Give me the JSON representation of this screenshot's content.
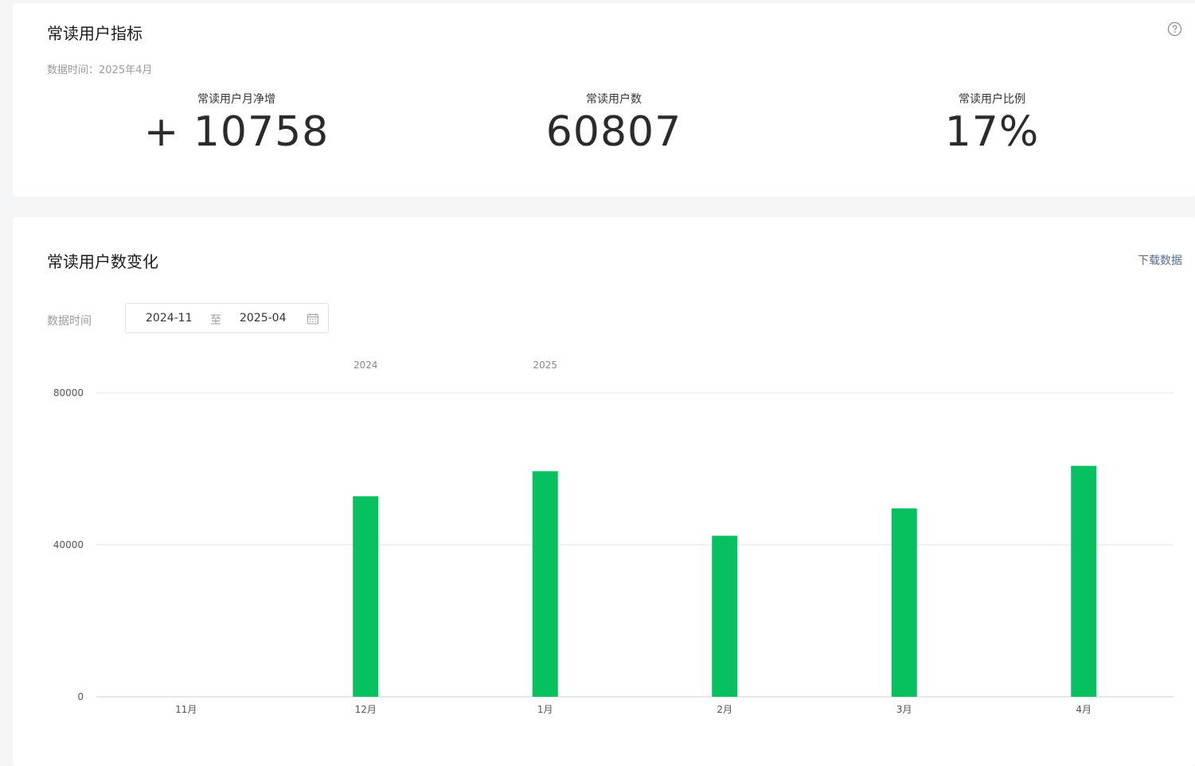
{
  "metrics_card": {
    "title": "常读用户指标",
    "help_icon": "question-circle-icon",
    "data_time": "数据时间：2025年4月",
    "metrics": [
      {
        "label": "常读用户月净增",
        "value": "+ 10758"
      },
      {
        "label": "常读用户数",
        "value": "60807"
      },
      {
        "label": "常读用户比例",
        "value": "17%"
      }
    ]
  },
  "trend_card": {
    "title": "常读用户数变化",
    "download_label": "下载数据",
    "range_label": "数据时间",
    "range_start": "2024-11",
    "range_separator": "至",
    "range_end": "2025-04",
    "calendar_icon": "calendar-icon"
  },
  "colors": {
    "bar": "#07c160",
    "grid": "#e5e5e5",
    "link": "#576b95"
  },
  "chart_data": {
    "type": "bar",
    "categories": [
      "11月",
      "12月",
      "1月",
      "2月",
      "3月",
      "4月"
    ],
    "year_labels": [
      {
        "label": "2024",
        "category": "12月"
      },
      {
        "label": "2025",
        "category": "1月"
      }
    ],
    "values": [
      0,
      52800,
      59400,
      42400,
      49600,
      60807
    ],
    "ylim": [
      0,
      80000
    ],
    "yticks": [
      0,
      40000,
      80000
    ],
    "grid": true,
    "xlabel": "",
    "ylabel": "",
    "title": ""
  }
}
